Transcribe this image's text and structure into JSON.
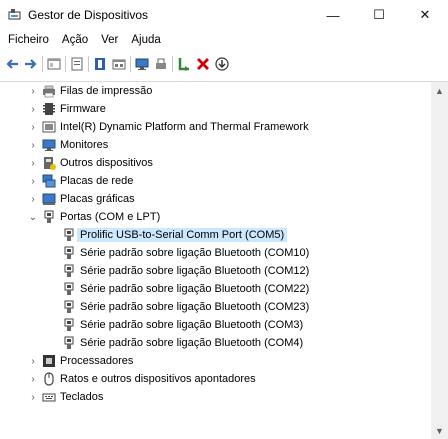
{
  "window": {
    "title": "Gestor de Dispositivos",
    "minimize": "—",
    "maximize": "☐",
    "close": "✕"
  },
  "menu": [
    "Ficheiro",
    "Ação",
    "Ver",
    "Ajuda"
  ],
  "tree": {
    "categories": [
      {
        "label": "Filas de impressão",
        "icon": "printer-queue-icon",
        "expanded": false
      },
      {
        "label": "Firmware",
        "icon": "firmware-icon",
        "expanded": false
      },
      {
        "label": "Intel(R) Dynamic Platform and Thermal Framework",
        "icon": "intel-framework-icon",
        "expanded": false
      },
      {
        "label": "Monitores",
        "icon": "monitor-icon",
        "expanded": false
      },
      {
        "label": "Outros dispositivos",
        "icon": "unknown-device-icon",
        "expanded": false
      },
      {
        "label": "Placas de rede",
        "icon": "network-adapter-icon",
        "expanded": false
      },
      {
        "label": "Placas gráficas",
        "icon": "display-adapter-icon",
        "expanded": false
      },
      {
        "label": "Portas (COM e LPT)",
        "icon": "port-icon",
        "expanded": true
      }
    ],
    "ports": [
      {
        "label": "Prolific USB-to-Serial Comm Port (COM5)",
        "selected": true
      },
      {
        "label": "Série padrão sobre ligação Bluetooth (COM10)",
        "selected": false
      },
      {
        "label": "Série padrão sobre ligação Bluetooth (COM12)",
        "selected": false
      },
      {
        "label": "Série padrão sobre ligação Bluetooth (COM22)",
        "selected": false
      },
      {
        "label": "Série padrão sobre ligação Bluetooth (COM23)",
        "selected": false
      },
      {
        "label": "Série padrão sobre ligação Bluetooth (COM3)",
        "selected": false
      },
      {
        "label": "Série padrão sobre ligação Bluetooth (COM4)",
        "selected": false
      }
    ],
    "after": [
      {
        "label": "Processadores",
        "icon": "processor-icon",
        "expanded": false
      },
      {
        "label": "Ratos e outros dispositivos apontadores",
        "icon": "mouse-icon",
        "expanded": false
      },
      {
        "label": "Teclados",
        "icon": "keyboard-icon",
        "expanded": false
      }
    ]
  },
  "colors": {
    "selection": "#cce8ff",
    "delete_red": "#d00000",
    "enable_green": "#2e8b2e"
  }
}
